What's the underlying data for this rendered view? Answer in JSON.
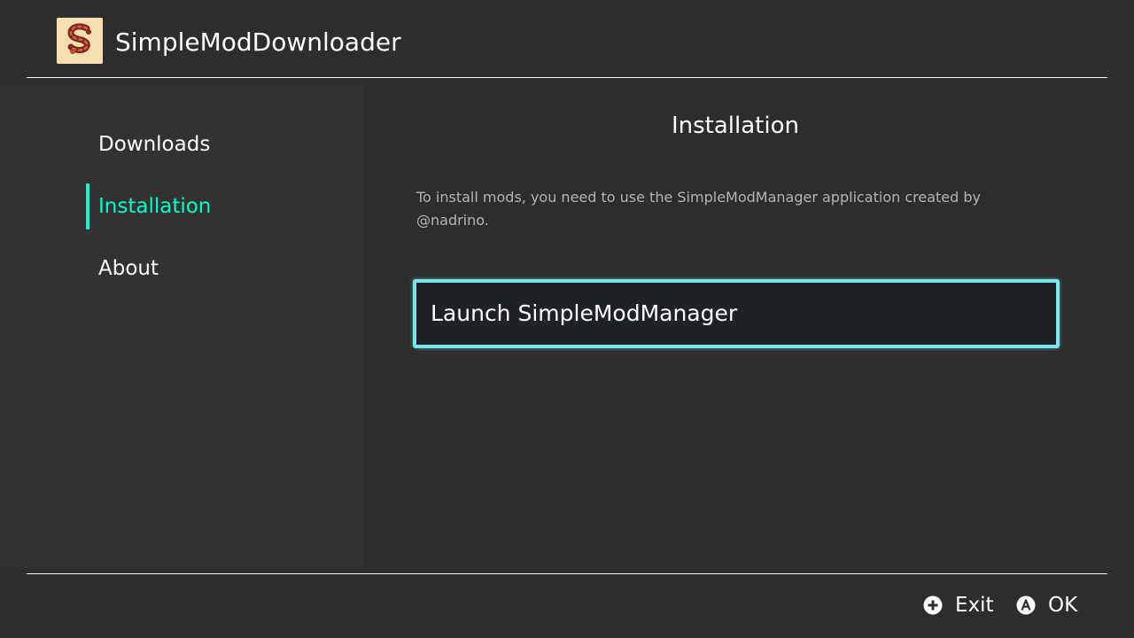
{
  "header": {
    "app_title": "SimpleModDownloader",
    "icon": "app-logo-icon"
  },
  "sidebar": {
    "items": [
      {
        "label": "Downloads",
        "active": false
      },
      {
        "label": "Installation",
        "active": true
      },
      {
        "label": "About",
        "active": false
      }
    ],
    "accent_color": "#00ffc8"
  },
  "main": {
    "title": "Installation",
    "description": "To install mods, you need to use the SimpleModManager application created by @nadrino.",
    "launch_button_label": "Launch SimpleModManager",
    "focus_color": "#78e6ec"
  },
  "footer": {
    "hints": [
      {
        "icon": "plus-button-icon",
        "label": "Exit"
      },
      {
        "icon": "a-button-icon",
        "label": "OK"
      }
    ]
  }
}
